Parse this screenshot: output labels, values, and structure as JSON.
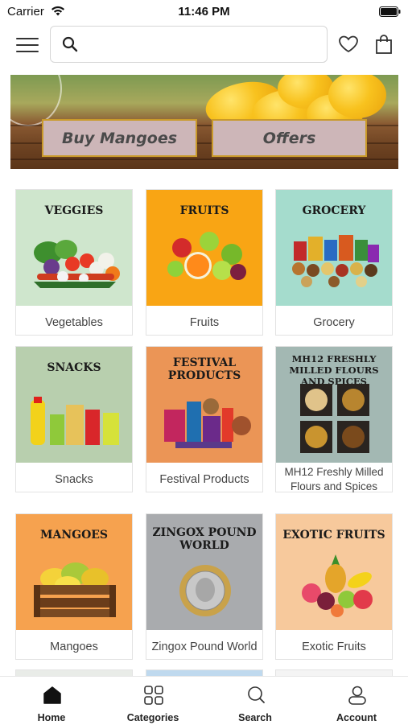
{
  "status_bar": {
    "carrier": "Carrier",
    "time": "11:46 PM"
  },
  "header": {
    "search_placeholder": "",
    "search_value": ""
  },
  "banner": {
    "buy_label": "Buy Mangoes",
    "offers_label": "Offers"
  },
  "categories": [
    {
      "image_title": "VEGGIES",
      "label": "Vegetables",
      "bg": "#cfe6cd"
    },
    {
      "image_title": "FRUITS",
      "label": "Fruits",
      "bg": "#f9a514"
    },
    {
      "image_title": "GROCERY",
      "label": "Grocery",
      "bg": "#a5dccd"
    },
    {
      "image_title": "SNACKS",
      "label": "Snacks",
      "bg": "#b8cfae"
    },
    {
      "image_title": "FESTIVAL PRODUCTS",
      "label": "Festival Products",
      "bg": "#eb9556"
    },
    {
      "image_title": "MH12 FRESHLY MILLED FLOURS AND SPICES",
      "label": "MH12 Freshly Milled Flours and Spices",
      "bg": "#a3b8b3"
    },
    {
      "image_title": "MANGOES",
      "label": "Mangoes",
      "bg": "#f6a24f"
    },
    {
      "image_title": "ZINGOX POUND WORLD",
      "label": "Zingox Pound World",
      "bg": "#a9abae"
    },
    {
      "image_title": "EXOTIC FRUITS",
      "label": "Exotic Fruits",
      "bg": "#f7c99c"
    }
  ],
  "tabs": [
    {
      "label": "Home",
      "icon": "home-icon"
    },
    {
      "label": "Categories",
      "icon": "categories-icon"
    },
    {
      "label": "Search",
      "icon": "search-icon"
    },
    {
      "label": "Account",
      "icon": "account-icon"
    }
  ]
}
